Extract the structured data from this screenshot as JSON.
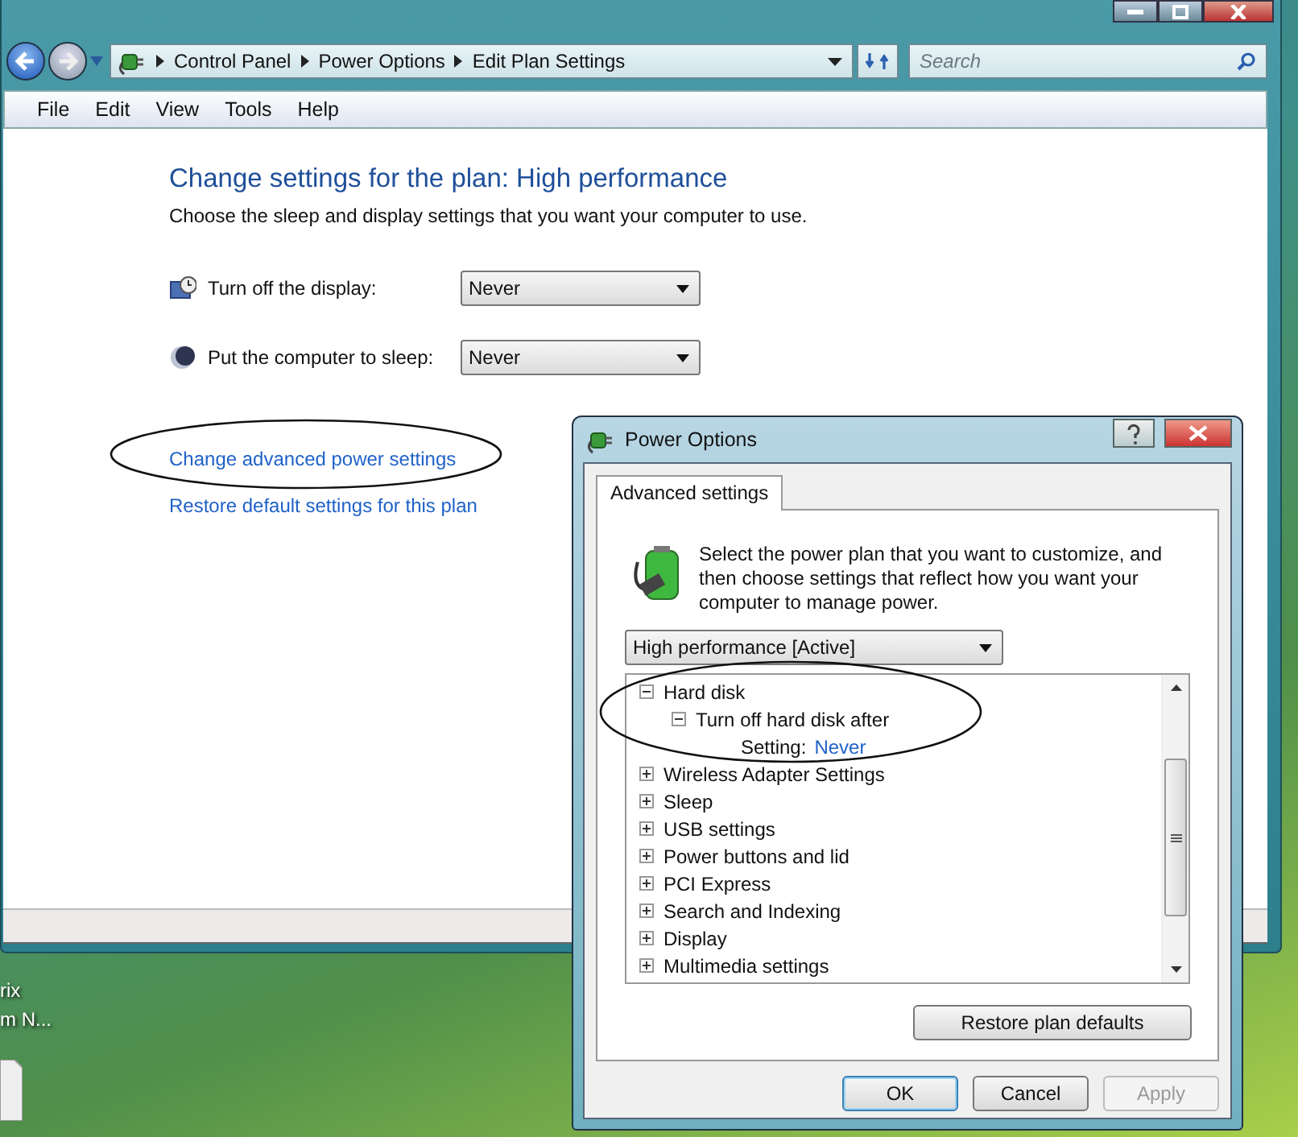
{
  "address_bar": {
    "breadcrumbs": [
      "Control Panel",
      "Power Options",
      "Edit Plan Settings"
    ]
  },
  "search": {
    "placeholder": "Search"
  },
  "menu": [
    "File",
    "Edit",
    "View",
    "Tools",
    "Help"
  ],
  "page": {
    "heading": "Change settings for the plan: High performance",
    "subtitle": "Choose the sleep and display settings that you want your computer to use.",
    "settings": [
      {
        "kind": "display",
        "label": "Turn off the display:",
        "value": "Never"
      },
      {
        "kind": "sleep",
        "label": "Put the computer to sleep:",
        "value": "Never"
      }
    ],
    "links": [
      "Change advanced power settings",
      "Restore default settings for this plan"
    ]
  },
  "desktop_icon": {
    "label_lines": [
      "rix",
      "m N..."
    ]
  },
  "dialog": {
    "title": "Power Options",
    "tabs": [
      {
        "label": "Advanced settings",
        "selected": true
      }
    ],
    "description": "Select the power plan that you want to customize, and then choose settings that reflect how you want your computer to manage power.",
    "plan": "High performance [Active]",
    "tree": [
      {
        "kind": "group",
        "label": "Hard disk",
        "expanded": true,
        "children": [
          {
            "kind": "group",
            "label": "Turn off hard disk after",
            "expanded": true,
            "children": [
              {
                "kind": "setting",
                "label": "Setting:",
                "value": "Never"
              }
            ]
          }
        ]
      },
      {
        "kind": "group",
        "label": "Wireless Adapter Settings",
        "expanded": false
      },
      {
        "kind": "group",
        "label": "Sleep",
        "expanded": false
      },
      {
        "kind": "group",
        "label": "USB settings",
        "expanded": false
      },
      {
        "kind": "group",
        "label": "Power buttons and lid",
        "expanded": false
      },
      {
        "kind": "group",
        "label": "PCI Express",
        "expanded": false
      },
      {
        "kind": "group",
        "label": "Search and Indexing",
        "expanded": false
      },
      {
        "kind": "group",
        "label": "Display",
        "expanded": false
      },
      {
        "kind": "group",
        "label": "Multimedia settings",
        "expanded": false
      }
    ],
    "restore_button": "Restore plan defaults",
    "buttons": [
      {
        "label": "OK",
        "default": true,
        "disabled": false
      },
      {
        "label": "Cancel",
        "default": false,
        "disabled": false
      },
      {
        "label": "Apply",
        "default": false,
        "disabled": true
      }
    ]
  }
}
